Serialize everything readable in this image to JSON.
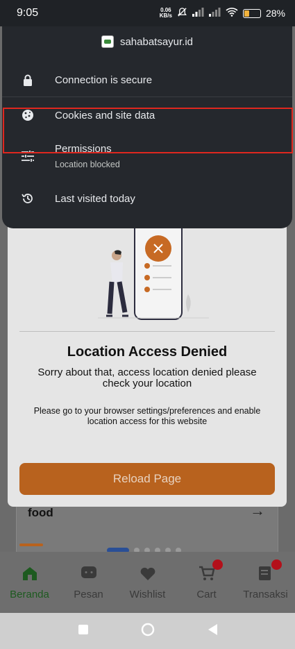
{
  "status_bar": {
    "time": "9:05",
    "net_speed_value": "0.06",
    "net_speed_unit": "KB/s",
    "battery": "28%"
  },
  "site_info": {
    "domain": "sahabatsayur.id",
    "items": [
      {
        "icon": "lock-icon",
        "label": "Connection is secure"
      },
      {
        "icon": "cookie-icon",
        "label": "Cookies and site data"
      },
      {
        "icon": "tune-icon",
        "label": "Permissions",
        "sub": "Location blocked"
      },
      {
        "icon": "history-icon",
        "label": "Last visited today"
      }
    ]
  },
  "modal": {
    "title": "Location Access Denied",
    "subtitle": "Sorry about that, access location denied please check your location",
    "note": "Please go to your browser settings/preferences and enable location access for this website",
    "button": "Reload Page"
  },
  "background": {
    "card_text": "food"
  },
  "bottom_nav": [
    {
      "label": "Beranda",
      "icon": "home-icon"
    },
    {
      "label": "Pesan",
      "icon": "chat-icon"
    },
    {
      "label": "Wishlist",
      "icon": "heart-icon"
    },
    {
      "label": "Cart",
      "icon": "cart-icon"
    },
    {
      "label": "Transaksi",
      "icon": "receipt-icon"
    }
  ],
  "colors": {
    "accent": "#b8621e",
    "highlight": "#e0271f",
    "popup_bg": "#25282d"
  }
}
